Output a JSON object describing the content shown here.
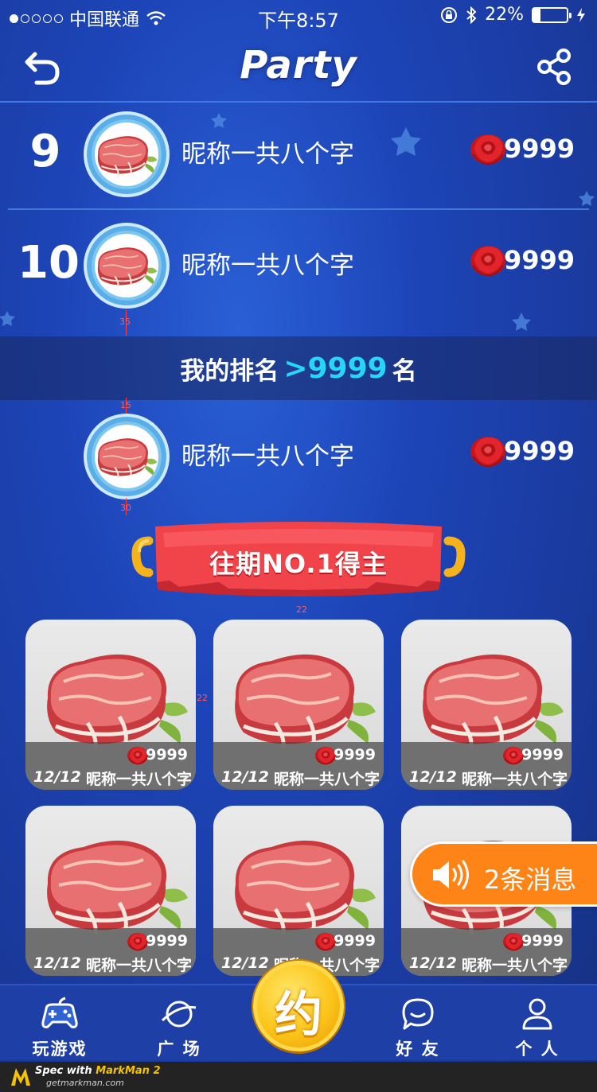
{
  "status_bar": {
    "carrier": "中国联通",
    "time": "下午8:57",
    "battery_percent": "22%",
    "battery_level": 0.22
  },
  "header": {
    "title": "Party"
  },
  "ranking": [
    {
      "rank": "9",
      "nickname": "昵称一共八个字",
      "score": "9999"
    },
    {
      "rank": "10",
      "nickname": "昵称一共八个字",
      "score": "9999"
    }
  ],
  "my_rank": {
    "prefix": "我的排名",
    "value": ">9999",
    "suffix": "名",
    "nickname": "昵称一共八个字",
    "score": "9999"
  },
  "banner": {
    "label": "往期NO.1得主"
  },
  "past_winners": [
    {
      "date": "12/12",
      "nickname": "昵称一共八个字",
      "score": "9999"
    },
    {
      "date": "12/12",
      "nickname": "昵称一共八个字",
      "score": "9999"
    },
    {
      "date": "12/12",
      "nickname": "昵称一共八个字",
      "score": "9999"
    },
    {
      "date": "12/12",
      "nickname": "昵称一共八个字",
      "score": "9999"
    },
    {
      "date": "12/12",
      "nickname": "昵称一共八个字",
      "score": "9999"
    },
    {
      "date": "12/12",
      "nickname": "昵称一共八个字",
      "score": "9999"
    }
  ],
  "toast": {
    "label": "2条消息",
    "icon": "speaker-icon"
  },
  "tabbar": {
    "items": [
      {
        "label": "玩游戏",
        "icon": "gamepad-icon"
      },
      {
        "label": "广 场",
        "icon": "planet-icon"
      },
      {
        "label": "好 友",
        "icon": "chat-bubble-icon"
      },
      {
        "label": "个 人",
        "icon": "person-icon"
      }
    ],
    "center_label": "约"
  },
  "spec_markers": {
    "m1": "35",
    "m2": "15",
    "m3": "30",
    "m4": "22",
    "m5": "22"
  },
  "watermark": {
    "line1_prefix": "Spec with ",
    "line1_brand": "MarkMan 2",
    "line2": "getmarkman.com"
  },
  "colors": {
    "background": "#1d45b8",
    "accent_cyan": "#27d6f6",
    "toast_orange": "#ff8418",
    "banner_red": "#f0434a",
    "coin_gold": "#fcc51a"
  }
}
